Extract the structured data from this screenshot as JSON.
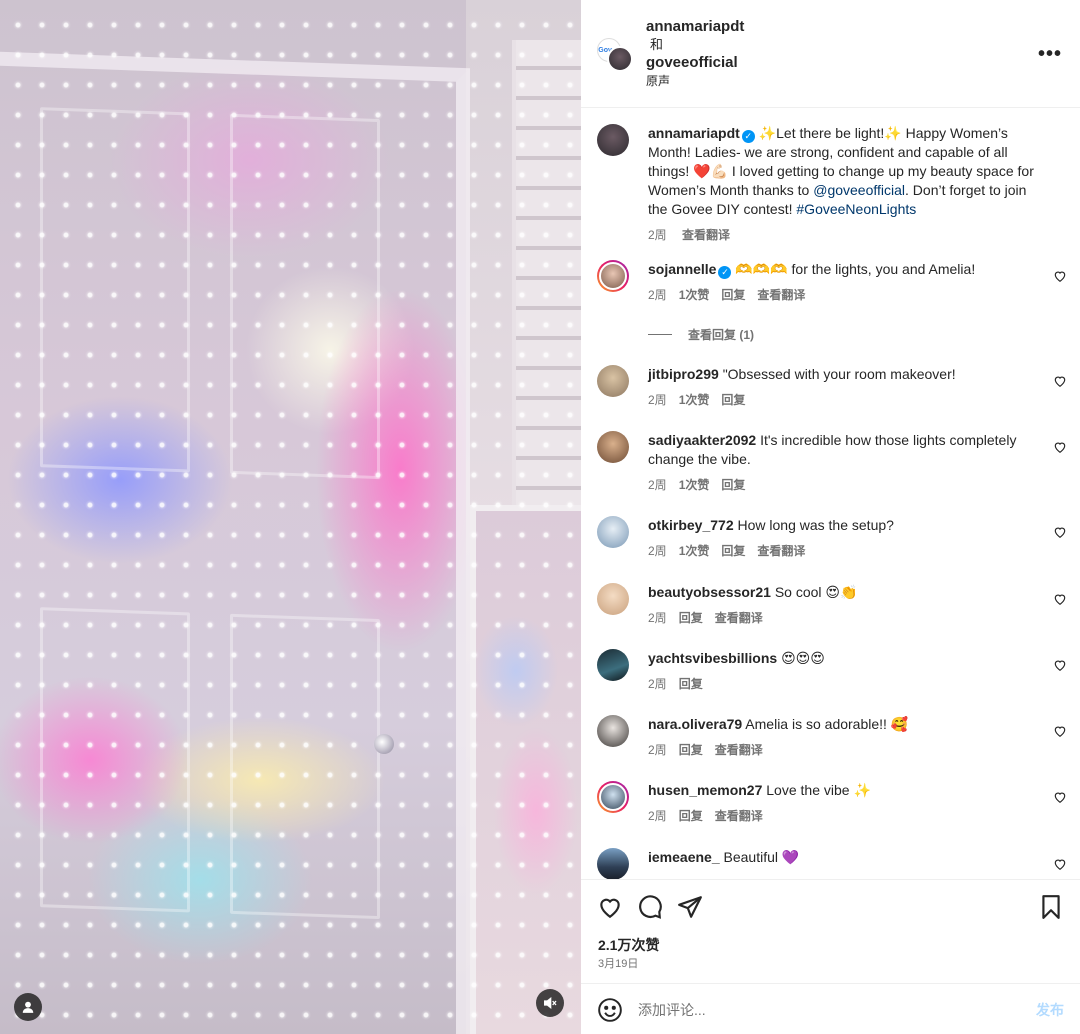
{
  "media": {
    "account_icon": "user-icon",
    "mute_icon": "speaker-muted-icon"
  },
  "header": {
    "author": "annamariapdt",
    "conjunction": "和",
    "coauthor": "goveeofficial",
    "audio": "原声",
    "more": "•••"
  },
  "caption": {
    "username": "annamariapdt",
    "verified": true,
    "text_1": "✨Let there be light!✨ Happy Women’s Month! Ladies- we are strong, confident and capable of all things! ❤️💪🏻 I loved getting to change up my beauty space for Women’s Month thanks to ",
    "mention": "@goveeofficial",
    "text_2": ". Don’t forget to join the Govee DIY contest! ",
    "hashtag": "#GoveeNeonLights",
    "time": "2周",
    "translate": "查看翻译"
  },
  "comments": [
    {
      "username": "sojannelle",
      "verified": true,
      "text": "🫶🫶🫶 for the lights, you and Amelia!",
      "time": "2周",
      "likes": "1次赞",
      "reply": "回复",
      "translate": "查看翻译"
    },
    {
      "username": "jitbipro299",
      "text": "\"Obsessed with your room makeover!",
      "time": "2周",
      "likes": "1次赞",
      "reply": "回复"
    },
    {
      "username": "sadiyaakter2092",
      "text": "It's incredible how those lights completely change the vibe.",
      "time": "2周",
      "likes": "1次赞",
      "reply": "回复"
    },
    {
      "username": "otkirbey_772",
      "text": "How long was the setup?",
      "time": "2周",
      "likes": "1次赞",
      "reply": "回复",
      "translate": "查看翻译"
    },
    {
      "username": "beautyobsessor21",
      "text": "So cool 😍👏",
      "time": "2周",
      "reply": "回复",
      "translate": "查看翻译"
    },
    {
      "username": "yachtsvibesbillions",
      "text": "😍😍😍",
      "time": "2周",
      "reply": "回复"
    },
    {
      "username": "nara.olivera79",
      "text": "Amelia is so adorable!! 🥰",
      "time": "2周",
      "reply": "回复",
      "translate": "查看翻译"
    },
    {
      "username": "husen_memon27",
      "text": "Love the vibe ✨",
      "time": "2周",
      "reply": "回复",
      "translate": "查看翻译"
    },
    {
      "username": "iemeaene_",
      "text": "Beautiful 💜",
      "time": "",
      "reply": ""
    }
  ],
  "view_replies": "查看回复 (1)",
  "actions": {
    "likes": "2.1万次赞",
    "date": "3月19日"
  },
  "composer": {
    "placeholder": "添加评论...",
    "post": "发布"
  }
}
